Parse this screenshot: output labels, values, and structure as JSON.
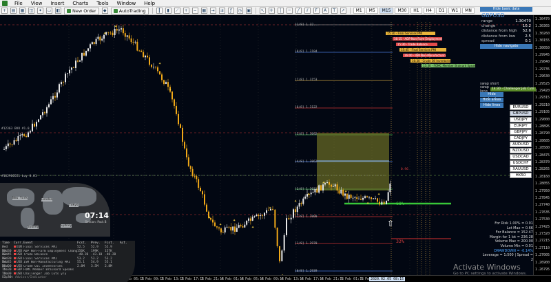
{
  "menubar": {
    "items": [
      "File",
      "View",
      "Insert",
      "Charts",
      "Tools",
      "Window",
      "Help"
    ]
  },
  "toolbar": {
    "new_order": "New Order",
    "autotrading": "AutoTrading",
    "timeframes": [
      "M1",
      "M5",
      "M15",
      "M30",
      "H1",
      "H4",
      "D1",
      "W1",
      "MN"
    ],
    "active_timeframe": "M15"
  },
  "price_scale": [
    "1.30470",
    "1.30365",
    "1.30260",
    "1.30155",
    "1.30050",
    "1.29945",
    "1.29840",
    "1.29735",
    "1.29630",
    "1.29525",
    "1.29420",
    "1.29315",
    "1.29210",
    "1.29105",
    "1.29000",
    "1.28895",
    "1.28790",
    "1.28685",
    "1.28580",
    "1.28475",
    "1.28370",
    "1.28265",
    "1.28160",
    "1.28055",
    "1.27950",
    "1.27845",
    "1.27740",
    "1.27635",
    "1.27530",
    "1.27425",
    "1.27320",
    "1.27215",
    "1.27110",
    "1.27005",
    "1.26900",
    "1.26795"
  ],
  "time_scale": [
    "30 Jan 2020",
    "31 Jan 09:15",
    "31 Jan 13:15",
    "31 Jan 17:15",
    "31 Jan 21:15",
    "3 Feb 01:15",
    "3 Feb 05:15",
    "3 Feb 09:15",
    "3 Feb 13:15",
    "3 Feb 17:15",
    "3 Feb 21:15",
    "4 Feb 01:15",
    "4 Feb 05:15",
    "4 Feb 09:15",
    "4 Feb 13:15",
    "4 Feb 17:15",
    "4 Feb 21:15",
    "5 Feb 01:15",
    "5 Feb 05:15"
  ],
  "time_scale_highlight": "2020.02.05 08:15",
  "levels": [
    {
      "label": "[1/8] 1.32..."
    },
    {
      "label": "[8/8] 1.3184"
    },
    {
      "label": "[7/8] 1.3153"
    },
    {
      "label": "[6/8] 1.3122"
    },
    {
      "label": "[5/8] 1.3092"
    },
    {
      "label": "[4/8] 1.3062"
    },
    {
      "label": "[3/8] 1.3031"
    },
    {
      "label": "[2/8] 1.3000"
    },
    {
      "label": "[1/8] 1.2970"
    },
    {
      "label": "[0/8] 1.2939"
    }
  ],
  "left_labels": [
    "#12363 BVO #1.0",
    "#1629605I1 buy 0.01"
  ],
  "news_bars": [
    "15:30 - Final Services PMI",
    "16:15 - ADP Non-Farm Employment Change",
    "15:30 - Trade Balance",
    "15:45 - Final Services PMI",
    "16:00 - ISM Non-Manufacturing PMI",
    "16:30 - Crude Oil Inventories",
    "15:30 - FOMC Member Brainard Speaks"
  ],
  "chart_texts": {
    "pct_green": "68%",
    "pct_red": "32%",
    "mark": "0.96"
  },
  "right_panel": {
    "hide_btn": "Hide basic data",
    "symbol": "GBPUSD",
    "rows": [
      {
        "k": "range",
        "v": "1.30470"
      },
      {
        "k": "change",
        "v": "10.2"
      },
      {
        "k": "distance from high",
        "v": "52.6"
      },
      {
        "k": "distance from low",
        "v": "2.5"
      },
      {
        "k": "spread",
        "v": "0.1"
      }
    ],
    "navigate_btn": "Hide navigate"
  },
  "side_rows": [
    {
      "label": "swap short",
      "tag": ""
    },
    {
      "label": "swap long",
      "tag": "14:30 - Challenger Job Cuts"
    },
    {
      "label": "Hide calendar",
      "tag": ""
    },
    {
      "label": "Hide areas",
      "tag": ""
    },
    {
      "label": "Hide lines",
      "tag": ""
    }
  ],
  "symbols": [
    "EURUSD",
    "GBPUSD",
    "USDJPY",
    "EURJPY",
    "GBPJPY",
    "CADJPY",
    "AUDUSD",
    "NZDUSD",
    "USDCAD",
    "USDCHF",
    "XAUUSD",
    "HK50"
  ],
  "selected_symbol": "GBPUSD",
  "clock": {
    "time": "07:14",
    "sub": "Session: Pack B"
  },
  "world_labels": [
    "New York",
    "London",
    "Tokyo",
    "Sydney",
    "Sydney"
  ],
  "news_table": {
    "headers": [
      "Time",
      "Curr.",
      "Event",
      "Fcst.",
      "Prev.",
      "Fcst.",
      "Act."
    ],
    "rows": [
      [
        "Wed 13:30",
        "EUR",
        "Final Services PMI",
        "52.5",
        "52.9",
        "52.9",
        ""
      ],
      [
        "Wed 13:45",
        "USD",
        "ADP Non-Farm Employment Change",
        "156K",
        "199K",
        "157K",
        ""
      ],
      [
        "Wed 13:30",
        "USD",
        "Trade Balance",
        "-48.2B",
        "-43.1B",
        "-48.2B",
        ""
      ],
      [
        "Wed 14:45",
        "USD",
        "Final Services PMI",
        "53.2",
        "53.2",
        "53.2",
        ""
      ],
      [
        "Wed 15:00",
        "USD",
        "ISM Non-Manufacturing PMI",
        "55.1",
        "54.9",
        "55.1",
        ""
      ],
      [
        "Wed 15:30",
        "USD",
        "Crude Oil Inventories",
        "2.8M",
        "3.5M",
        "2.8M",
        ""
      ],
      [
        "Thu 13:00",
        "GBP",
        "FOMC Member Brainard Speaks",
        "",
        "",
        "",
        ""
      ],
      [
        "Thu 13:30",
        "USD",
        "Challenger Job Cuts y/y",
        "",
        "",
        "",
        ""
      ]
    ],
    "footer": "Expert Advisor/Indicator"
  },
  "stats": [
    {
      "t": "For Risk 1.00% = 0.01"
    },
    {
      "t": "Lot Max = 0.66"
    },
    {
      "t": "For Balance = 152.47"
    },
    {
      "t": "Margin for 1 lot = 236.28"
    },
    {
      "t": "Volume Max = 200.00"
    },
    {
      "t": "Volume Min = 0.01"
    },
    {
      "t": "DRAWDOWN = -0.14%",
      "blue": true
    },
    {
      "t": "Leverage = 1:500 | Spread = 2"
    }
  ],
  "watermark": {
    "title": "Activate Windows",
    "sub": "Go to PC settings to activate Windows."
  }
}
